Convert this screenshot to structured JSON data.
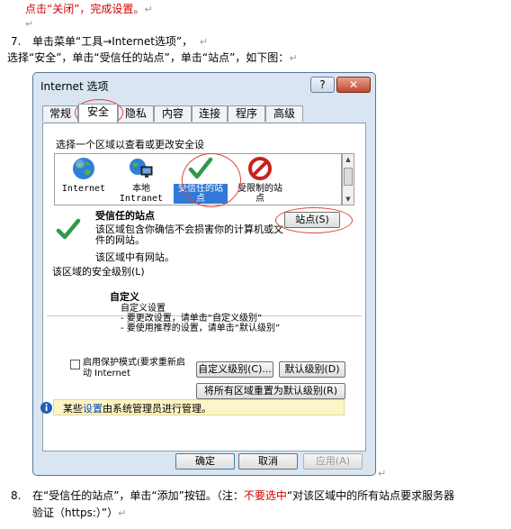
{
  "doc": {
    "line1": "点击“关闭”，完成设置。",
    "step7_num": "7.",
    "step7_text": "单击菜单“工具→Internet选项”，",
    "step7_line2": "选择“安全”，单击“受信任的站点”，单击“站点”，如下图：",
    "step8_num": "8.",
    "step8_pre": "在“受信任的站点”，单击“添加”按钮。（注：",
    "step8_red": "不要选中",
    "step8_post": "“对该区域中的所有站点要求服务器",
    "step8_line2": "验证（https:）”）",
    "para_mark": "↵"
  },
  "dialog": {
    "title": "Internet 选项",
    "help_label": "?",
    "close_label": "✕",
    "tabs": [
      "常规",
      "安全",
      "隐私",
      "内容",
      "连接",
      "程序",
      "高级"
    ],
    "zone_prompt": "选择一个区域以查看或更改安全设",
    "zones": [
      {
        "label": "Internet"
      },
      {
        "label": "本地\nIntranet"
      },
      {
        "label": "受信任的站\n点"
      },
      {
        "label": "受限制的站\n点"
      }
    ],
    "zone_heading": "受信任的站点",
    "zone_desc": "该区域包含你确信不会损害你的计算机或文件的网站。",
    "zone_has_sites": "该区域中有网站。",
    "sites_button": "站点(S)",
    "security_level_title": "该区域的安全级别(L)",
    "custom_title": "自定义",
    "custom_lines": [
      "自定义设置",
      "- 要更改设置，请单击“自定义级别”",
      "- 要使用推荐的设置，请单击“默认级别”"
    ],
    "protected_mode": "启用保护模式(要求重新启动 Internet",
    "custom_level_button": "自定义级别(C)...",
    "default_level_button": "默认级别(D)",
    "reset_all_button": "将所有区域重置为默认级别(R)",
    "info_pre": "某些",
    "info_link": "设置",
    "info_post": "由系统管理员进行管理。",
    "ok_button": "确定",
    "cancel_button": "取消",
    "apply_button": "应用(A)",
    "colors": {
      "accent": "#3278d6",
      "highlight": "#e0463a",
      "info": "#fcf5c7"
    }
  }
}
